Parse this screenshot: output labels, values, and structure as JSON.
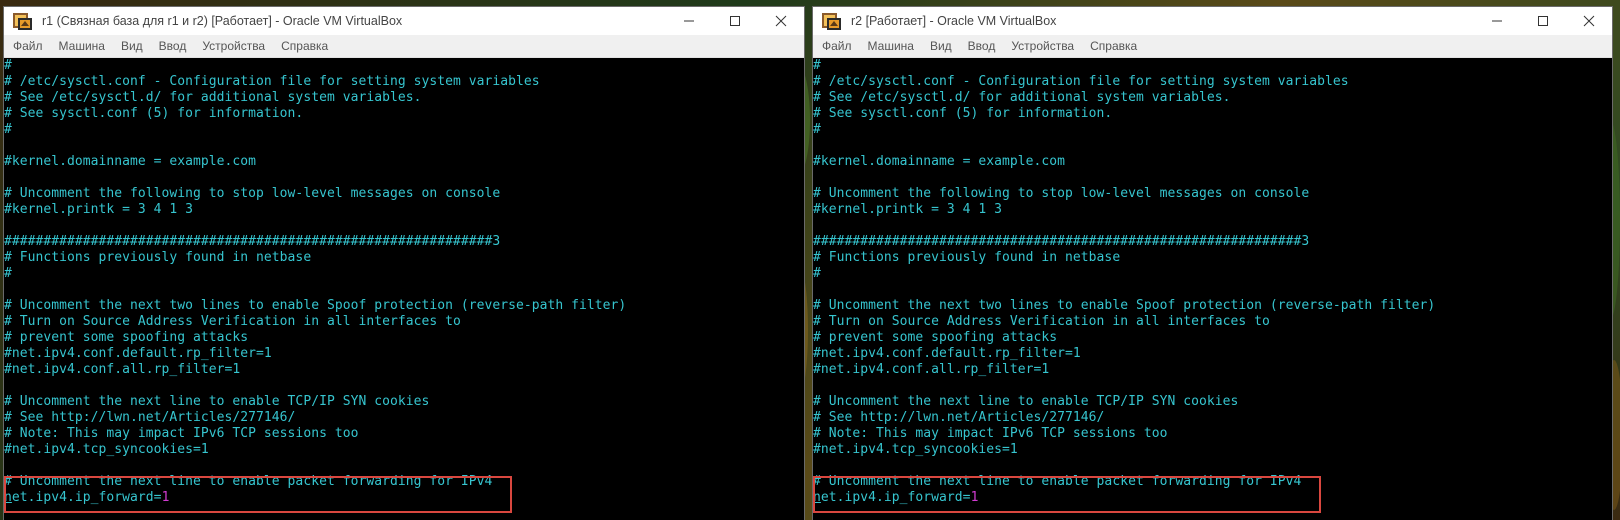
{
  "windows": [
    {
      "title": "r1 (Связная база для r1 и r2) [Работает] - Oracle VM VirtualBox",
      "menu": [
        "Файл",
        "Машина",
        "Вид",
        "Ввод",
        "Устройства",
        "Справка"
      ],
      "terminal_lines": [
        "#",
        "# /etc/sysctl.conf - Configuration file for setting system variables",
        "# See /etc/sysctl.d/ for additional system variables.",
        "# See sysctl.conf (5) for information.",
        "#",
        "",
        "#kernel.domainname = example.com",
        "",
        "# Uncomment the following to stop low-level messages on console",
        "#kernel.printk = 3 4 1 3",
        "",
        "##############################################################3",
        "# Functions previously found in netbase",
        "#",
        "",
        "# Uncomment the next two lines to enable Spoof protection (reverse-path filter)",
        "# Turn on Source Address Verification in all interfaces to",
        "# prevent some spoofing attacks",
        "#net.ipv4.conf.default.rp_filter=1",
        "#net.ipv4.conf.all.rp_filter=1",
        "",
        "# Uncomment the next line to enable TCP/IP SYN cookies",
        "# See http://lwn.net/Articles/277146/",
        "# Note: This may impact IPv6 TCP sessions too",
        "#net.ipv4.tcp_syncookies=1",
        "",
        "# Uncomment the next line to enable packet forwarding for IPv4"
      ],
      "last_line": {
        "cursor_char": "n",
        "text": "et.ipv4.ip_forward=",
        "value": "1"
      }
    },
    {
      "title": "r2 [Работает] - Oracle VM VirtualBox",
      "menu": [
        "Файл",
        "Машина",
        "Вид",
        "Ввод",
        "Устройства",
        "Справка"
      ],
      "terminal_lines": [
        "#",
        "# /etc/sysctl.conf - Configuration file for setting system variables",
        "# See /etc/sysctl.d/ for additional system variables.",
        "# See sysctl.conf (5) for information.",
        "#",
        "",
        "#kernel.domainname = example.com",
        "",
        "# Uncomment the following to stop low-level messages on console",
        "#kernel.printk = 3 4 1 3",
        "",
        "##############################################################3",
        "# Functions previously found in netbase",
        "#",
        "",
        "# Uncomment the next two lines to enable Spoof protection (reverse-path filter)",
        "# Turn on Source Address Verification in all interfaces to",
        "# prevent some spoofing attacks",
        "#net.ipv4.conf.default.rp_filter=1",
        "#net.ipv4.conf.all.rp_filter=1",
        "",
        "# Uncomment the next line to enable TCP/IP SYN cookies",
        "# See http://lwn.net/Articles/277146/",
        "# Note: This may impact IPv6 TCP sessions too",
        "#net.ipv4.tcp_syncookies=1",
        "",
        "# Uncomment the next line to enable packet forwarding for IPv4"
      ],
      "last_line": {
        "cursor_char": "n",
        "text": "et.ipv4.ip_forward=",
        "value": "1"
      }
    }
  ],
  "colors": {
    "terminal_text": "#36c5cf",
    "value_highlight": "#d23bd2",
    "annotation_box": "#d9473f",
    "terminal_bg": "#000000"
  },
  "icons": [
    "virtualbox-icon",
    "minimize-icon",
    "maximize-icon",
    "close-icon"
  ]
}
